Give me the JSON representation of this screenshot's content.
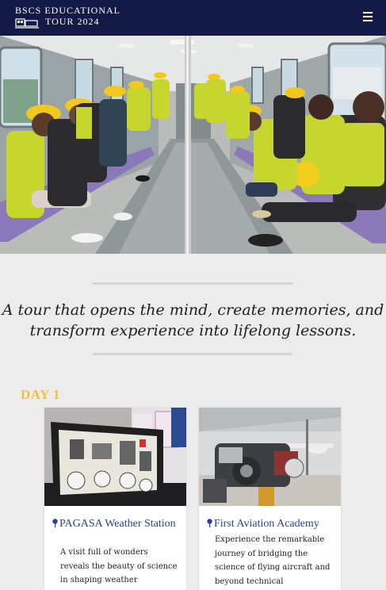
{
  "header": {
    "brand_line1": "BSCS EDUCATIONAL",
    "brand_line2": "TOUR 2024",
    "logo_icon": "train-icon",
    "menu_icon": "hamburger-menu-icon",
    "background": "#141a46"
  },
  "hero": {
    "subject": "students in hard hats and safety vests seated inside a train car"
  },
  "tagline": {
    "line1": "A tour that opens the mind, create memories, and",
    "line2": "transform experience into lifelong lessons."
  },
  "day": {
    "title": "DAY 1",
    "accent": "#f2be3f"
  },
  "cards": [
    {
      "icon": "location-pin-icon",
      "title": "PAGASA Weather Station",
      "desc": "A visit full of wonders reveals the beauty of science in shaping weather"
    },
    {
      "icon": "location-pin-icon",
      "title": "First Aviation Academy",
      "desc": "Experience the remarkable journey of bridging the science of flying aircraft and beyond technical"
    }
  ],
  "colors": {
    "page_bg": "#ececec",
    "link": "#2b3f9e",
    "rule": "#cdd9cf"
  }
}
